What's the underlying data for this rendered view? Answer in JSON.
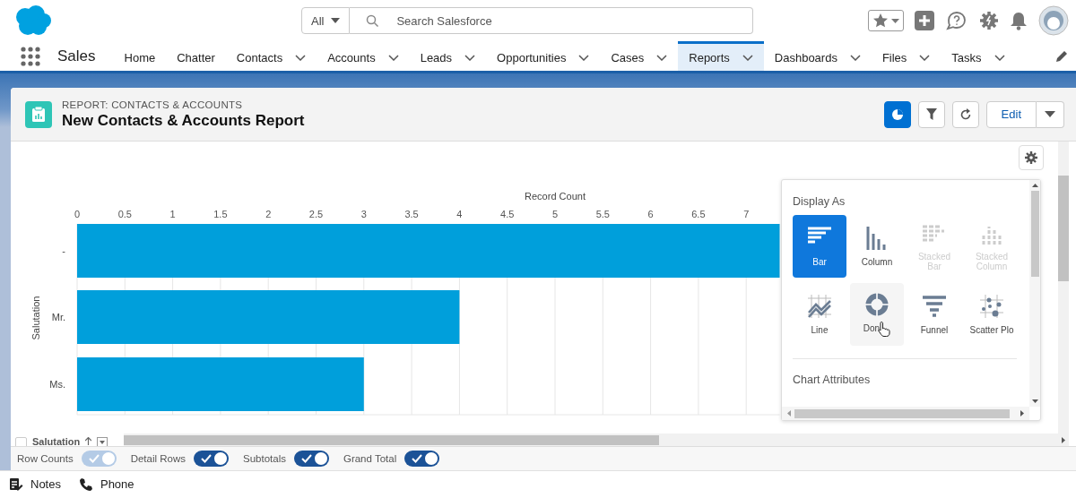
{
  "header": {
    "search_scope": "All",
    "search_placeholder": "Search Salesforce"
  },
  "nav": {
    "app_name": "Sales",
    "tabs": [
      {
        "label": "Home",
        "dropdown": false,
        "selected": false
      },
      {
        "label": "Chatter",
        "dropdown": false,
        "selected": false
      },
      {
        "label": "Contacts",
        "dropdown": true,
        "selected": false
      },
      {
        "label": "Accounts",
        "dropdown": true,
        "selected": false
      },
      {
        "label": "Leads",
        "dropdown": true,
        "selected": false
      },
      {
        "label": "Opportunities",
        "dropdown": true,
        "selected": false
      },
      {
        "label": "Cases",
        "dropdown": true,
        "selected": false
      },
      {
        "label": "Reports",
        "dropdown": true,
        "selected": true
      },
      {
        "label": "Dashboards",
        "dropdown": true,
        "selected": false
      },
      {
        "label": "Files",
        "dropdown": true,
        "selected": false
      },
      {
        "label": "Tasks",
        "dropdown": true,
        "selected": false
      }
    ]
  },
  "report": {
    "type_label": "REPORT: CONTACTS & ACCOUNTS",
    "title": "New Contacts & Accounts Report",
    "chart_toggle": {
      "selected": true
    },
    "edit_label": "Edit"
  },
  "chart": {
    "chart_data": {
      "type": "bar",
      "orientation": "horizontal",
      "xlabel": "Record Count",
      "ylabel": "Salutation",
      "categories": [
        "-",
        "Mr.",
        "Ms."
      ],
      "values": [
        7.35,
        4,
        3
      ],
      "grid": true,
      "xlim": [
        0,
        7.35
      ],
      "xticks": [
        0,
        0.5,
        1,
        1.5,
        2,
        2.5,
        3,
        3.5,
        4,
        4.5,
        5,
        5.5,
        6,
        6.5,
        7
      ]
    }
  },
  "display_panel": {
    "heading": "Display As",
    "options": [
      {
        "label": "Bar",
        "kind": "bar",
        "selected": true,
        "disabled": false,
        "hovered": false
      },
      {
        "label": "Column",
        "kind": "column",
        "selected": false,
        "disabled": false,
        "hovered": false
      },
      {
        "label": "Stacked Bar",
        "kind": "stacked-bar",
        "selected": false,
        "disabled": true,
        "hovered": false
      },
      {
        "label": "Stacked Column",
        "kind": "stacked-column",
        "selected": false,
        "disabled": true,
        "hovered": false
      },
      {
        "label": "Line",
        "kind": "line",
        "selected": false,
        "disabled": false,
        "hovered": false
      },
      {
        "label": "Don",
        "kind": "donut",
        "selected": false,
        "disabled": false,
        "hovered": true
      },
      {
        "label": "Funnel",
        "kind": "funnel",
        "selected": false,
        "disabled": false,
        "hovered": false
      },
      {
        "label": "Scatter Plo",
        "kind": "scatter",
        "selected": false,
        "disabled": false,
        "hovered": false
      }
    ],
    "section": "Chart Attributes"
  },
  "table_header": {
    "column": "Salutation",
    "checked": false
  },
  "toggles": [
    {
      "label": "Row Counts",
      "on": true,
      "disabled": true
    },
    {
      "label": "Detail Rows",
      "on": true,
      "disabled": false
    },
    {
      "label": "Subtotals",
      "on": true,
      "disabled": false
    },
    {
      "label": "Grand Total",
      "on": true,
      "disabled": false
    }
  ],
  "utility_bar": [
    {
      "label": "Notes",
      "kind": "notes"
    },
    {
      "label": "Phone",
      "kind": "phone"
    }
  ]
}
